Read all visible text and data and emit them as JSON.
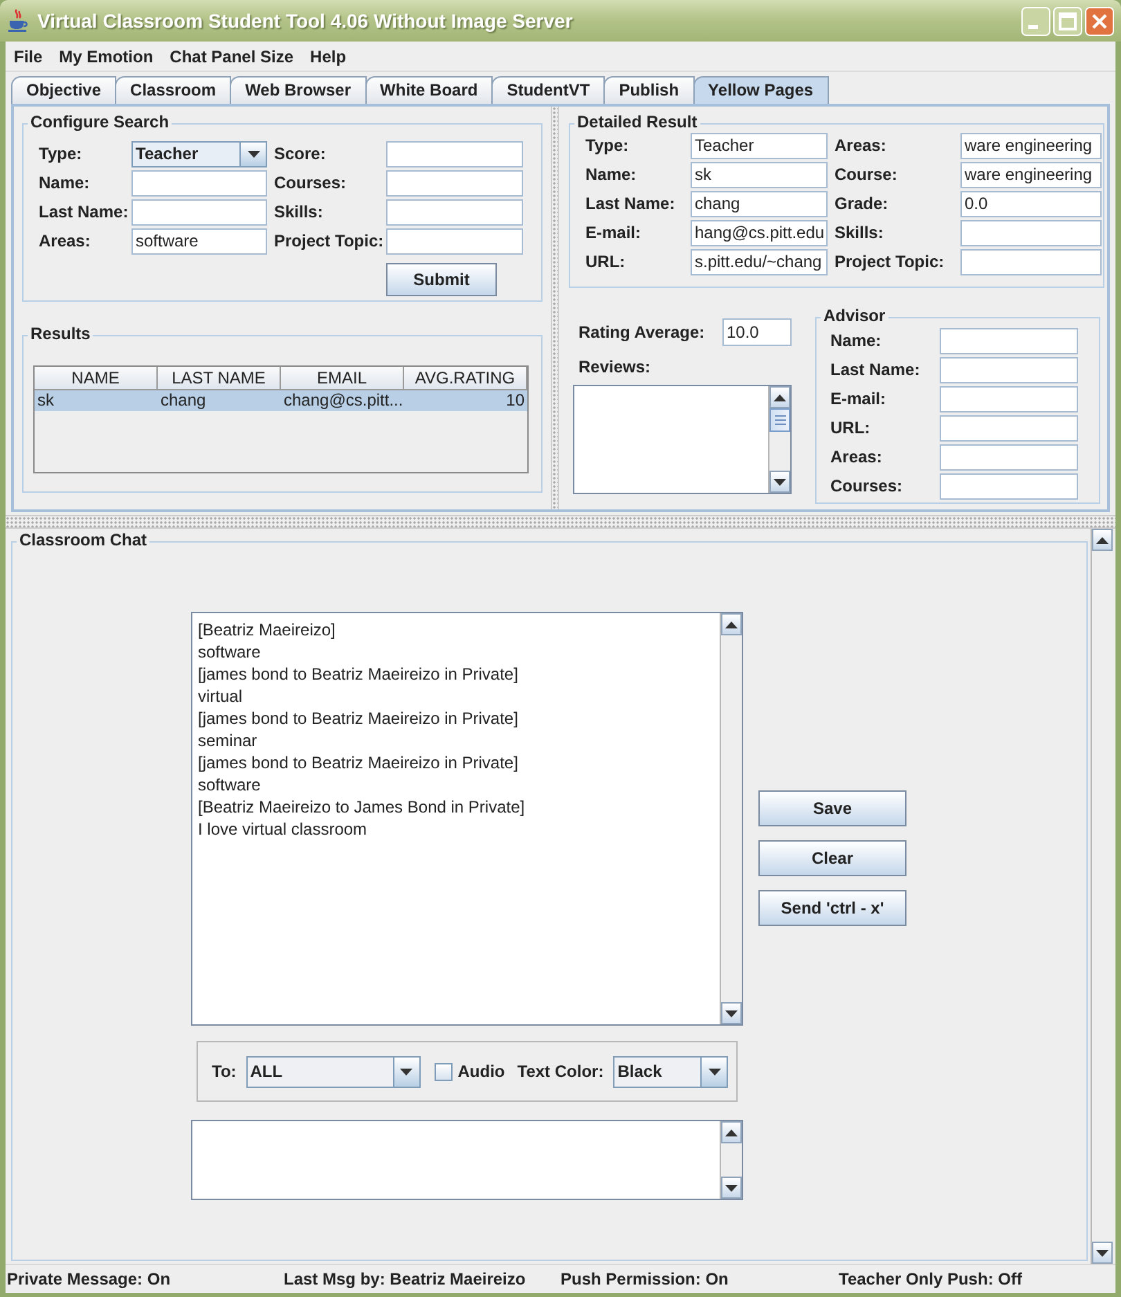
{
  "window": {
    "title": "Virtual Classroom Student Tool 4.06 Without Image Server"
  },
  "menu": [
    "File",
    "My Emotion",
    "Chat Panel Size",
    "Help"
  ],
  "tabs": [
    {
      "label": "Objective",
      "selected": false
    },
    {
      "label": "Classroom",
      "selected": false
    },
    {
      "label": "Web Browser",
      "selected": false
    },
    {
      "label": "White Board",
      "selected": false
    },
    {
      "label": "StudentVT",
      "selected": false
    },
    {
      "label": "Publish",
      "selected": false
    },
    {
      "label": "Yellow Pages",
      "selected": true
    }
  ],
  "configure_search": {
    "title": "Configure Search",
    "fields": [
      {
        "label": "Type:",
        "kind": "combo",
        "value": "Teacher"
      },
      {
        "label": "Score:",
        "kind": "text"
      },
      {
        "label": "Name:",
        "kind": "text"
      },
      {
        "label": "Courses:",
        "kind": "text"
      },
      {
        "label": "Last Name:",
        "kind": "text"
      },
      {
        "label": "Skills:",
        "kind": "text"
      },
      {
        "label": "Areas:",
        "kind": "text",
        "value": "software"
      },
      {
        "label": "Project Topic:",
        "kind": "text"
      }
    ],
    "submit": "Submit"
  },
  "results": {
    "title": "Results",
    "columns": [
      "NAME",
      "LAST NAME",
      "EMAIL",
      "AVG.RATING"
    ],
    "rows": [
      {
        "cells": [
          "sk",
          "chang",
          "chang@cs.pitt...",
          "10"
        ],
        "selected": true
      }
    ]
  },
  "detailed_result": {
    "title": "Detailed Result",
    "fields": [
      {
        "label": "Type:",
        "value": "Teacher"
      },
      {
        "label": "Areas:",
        "value": "ware engineering"
      },
      {
        "label": "Name:",
        "value": "sk"
      },
      {
        "label": "Course:",
        "value": "ware engineering"
      },
      {
        "label": "Last Name:",
        "value": "chang"
      },
      {
        "label": "Grade:",
        "value": "0.0"
      },
      {
        "label": "E-mail:",
        "value": "hang@cs.pitt.edu"
      },
      {
        "label": "Skills:"
      },
      {
        "label": "URL:",
        "value": "s.pitt.edu/~chang"
      },
      {
        "label": "Project Topic:"
      }
    ]
  },
  "rating": {
    "label": "Rating Average:",
    "value": "10.0"
  },
  "reviews": {
    "label": "Reviews:"
  },
  "advisor": {
    "title": "Advisor",
    "fields": [
      {
        "label": "Name:"
      },
      {
        "label": "Last Name:"
      },
      {
        "label": "E-mail:"
      },
      {
        "label": "URL:"
      },
      {
        "label": "Areas:"
      },
      {
        "label": "Courses:"
      }
    ]
  },
  "chat": {
    "title": "Classroom Chat",
    "messages": [
      "[Beatriz Maeireizo]",
      "software",
      "[james bond to Beatriz Maeireizo in Private]",
      "virtual",
      "[james bond to Beatriz Maeireizo in Private]",
      "seminar",
      "[james bond to Beatriz Maeireizo in Private]",
      "software",
      "[Beatriz Maeireizo to James Bond in Private]",
      "I love virtual classroom"
    ],
    "buttons": [
      "Save",
      "Clear",
      "Send 'ctrl - x'"
    ],
    "to": {
      "label": "To:",
      "value": "ALL"
    },
    "audio": {
      "label": "Audio",
      "checked": false
    },
    "text_color": {
      "label": "Text Color:",
      "value": "Black"
    }
  },
  "status_bar": [
    "Private Message: On",
    "Last Msg by: Beatriz Maeireizo",
    "Push Permission: On",
    "Teacher Only Push: Off"
  ]
}
